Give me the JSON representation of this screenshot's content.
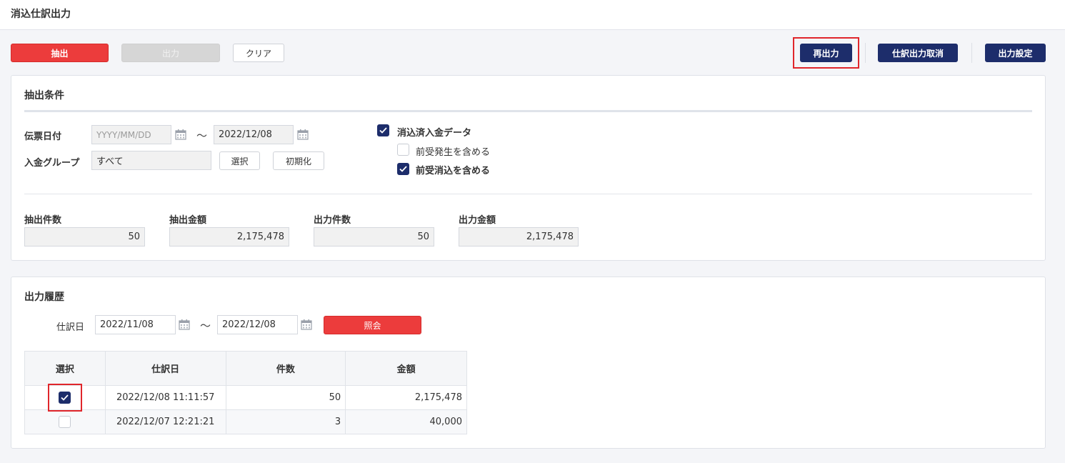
{
  "page": {
    "title": "消込仕訳出力"
  },
  "toolbar": {
    "extract": "抽出",
    "output": "出力",
    "clear": "クリア",
    "reoutput": "再出力",
    "cancel_output": "仕訳出力取消",
    "output_settings": "出力設定"
  },
  "conditions": {
    "title": "抽出条件",
    "date_label": "伝票日付",
    "date_from_placeholder": "YYYY/MM/DD",
    "date_to": "2022/12/08",
    "tilde": "～",
    "group_label": "入金グループ",
    "group_value": "すべて",
    "select_button": "選択",
    "init_button": "初期化",
    "checks": {
      "reconciled": {
        "label": "消込済入金データ",
        "checked": true
      },
      "include_advance_occur": {
        "label": "前受発生を含める",
        "checked": false
      },
      "include_advance_clear": {
        "label": "前受消込を含める",
        "checked": true
      }
    }
  },
  "summary": {
    "extract_count_label": "抽出件数",
    "extract_count": "50",
    "extract_amount_label": "抽出金額",
    "extract_amount": "2,175,478",
    "output_count_label": "出力件数",
    "output_count": "50",
    "output_amount_label": "出力金額",
    "output_amount": "2,175,478"
  },
  "history": {
    "title": "出力履歴",
    "date_label": "仕訳日",
    "date_from": "2022/11/08",
    "date_to": "2022/12/08",
    "tilde": "～",
    "query_button": "照会",
    "columns": [
      "選択",
      "仕訳日",
      "件数",
      "金額"
    ],
    "rows": [
      {
        "selected": true,
        "date": "2022/12/08 11:11:57",
        "count": "50",
        "amount": "2,175,478"
      },
      {
        "selected": false,
        "date": "2022/12/07 12:21:21",
        "count": "3",
        "amount": "40,000"
      }
    ]
  },
  "colors": {
    "accent_red": "#ec3c3c",
    "navy": "#1d2d6b",
    "highlight": "#e0262b"
  },
  "icons": [
    "calendar-icon",
    "checkmark-icon"
  ]
}
